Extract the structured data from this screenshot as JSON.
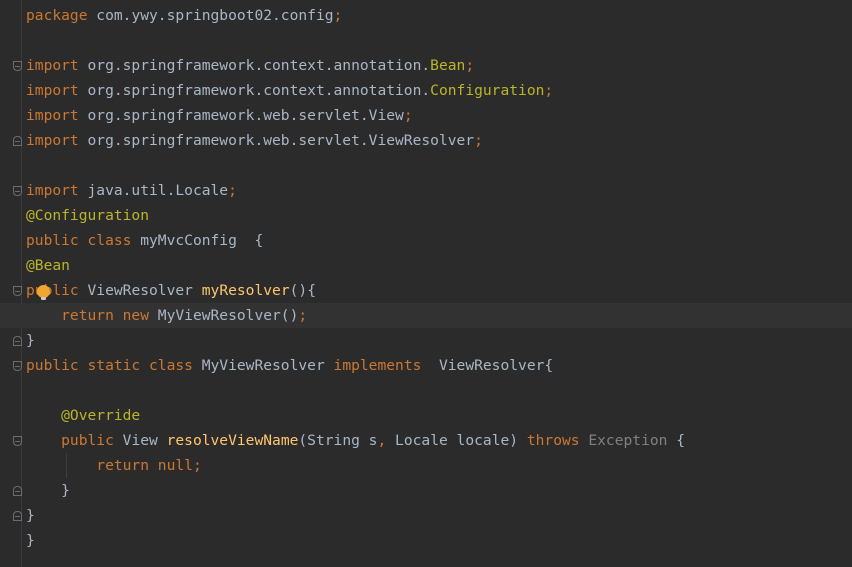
{
  "lines": [
    [
      {
        "t": "package",
        "c": "kw"
      },
      {
        "t": " com.ywy.springboot02.config",
        "c": "plain"
      },
      {
        "t": ";",
        "c": "kw"
      }
    ],
    [],
    [
      {
        "t": "import",
        "c": "kw"
      },
      {
        "t": " org.springframework.context.annotation.",
        "c": "plain"
      },
      {
        "t": "Bean",
        "c": "ann"
      },
      {
        "t": ";",
        "c": "kw"
      }
    ],
    [
      {
        "t": "import",
        "c": "kw"
      },
      {
        "t": " org.springframework.context.annotation.",
        "c": "plain"
      },
      {
        "t": "Configuration",
        "c": "ann"
      },
      {
        "t": ";",
        "c": "kw"
      }
    ],
    [
      {
        "t": "import",
        "c": "kw"
      },
      {
        "t": " org.springframework.web.servlet.View",
        "c": "plain"
      },
      {
        "t": ";",
        "c": "kw"
      }
    ],
    [
      {
        "t": "import",
        "c": "kw"
      },
      {
        "t": " org.springframework.web.servlet.ViewResolver",
        "c": "plain"
      },
      {
        "t": ";",
        "c": "kw"
      }
    ],
    [],
    [
      {
        "t": "import",
        "c": "kw"
      },
      {
        "t": " java.util.Locale",
        "c": "plain"
      },
      {
        "t": ";",
        "c": "kw"
      }
    ],
    [
      {
        "t": "@Configuration",
        "c": "ann"
      }
    ],
    [
      {
        "t": "public class ",
        "c": "kw"
      },
      {
        "t": "myMvcConfig  {",
        "c": "plain"
      }
    ],
    [
      {
        "t": "@Bean",
        "c": "ann"
      }
    ],
    [
      {
        "t": "public ",
        "c": "kw"
      },
      {
        "t": "ViewResolver ",
        "c": "plain"
      },
      {
        "t": "myResolver",
        "c": "fn"
      },
      {
        "t": "(){",
        "c": "plain"
      }
    ],
    [
      {
        "t": "    return new ",
        "c": "kw"
      },
      {
        "t": "MyViewResolver()",
        "c": "plain"
      },
      {
        "t": ";",
        "c": "kw"
      }
    ],
    [
      {
        "t": "}",
        "c": "plain"
      }
    ],
    [
      {
        "t": "public static class ",
        "c": "kw"
      },
      {
        "t": "MyViewResolver ",
        "c": "plain"
      },
      {
        "t": "implements  ",
        "c": "kw"
      },
      {
        "t": "ViewResolver{",
        "c": "plain"
      }
    ],
    [],
    [
      {
        "t": "    @Override",
        "c": "ann"
      }
    ],
    [
      {
        "t": "    public ",
        "c": "kw"
      },
      {
        "t": "View ",
        "c": "plain"
      },
      {
        "t": "resolveViewName",
        "c": "fn"
      },
      {
        "t": "(String s",
        "c": "plain"
      },
      {
        "t": ", ",
        "c": "kw"
      },
      {
        "t": "Locale locale) ",
        "c": "plain"
      },
      {
        "t": "throws ",
        "c": "kw"
      },
      {
        "t": "Exception",
        "c": "gray"
      },
      {
        "t": " {",
        "c": "plain"
      }
    ],
    [
      {
        "t": "        return null",
        "c": "kw"
      },
      {
        "t": ";",
        "c": "kw"
      }
    ],
    [
      {
        "t": "    }",
        "c": "plain"
      }
    ],
    [
      {
        "t": "}",
        "c": "plain"
      }
    ],
    [
      {
        "t": "}",
        "c": "plain"
      }
    ]
  ],
  "current_line_index": 12,
  "fold_markers": [
    {
      "line": 2,
      "dir": "down"
    },
    {
      "line": 5,
      "dir": "up"
    },
    {
      "line": 7,
      "dir": "down"
    },
    {
      "line": 11,
      "dir": "down"
    },
    {
      "line": 13,
      "dir": "up"
    },
    {
      "line": 14,
      "dir": "down"
    },
    {
      "line": 17,
      "dir": "down"
    },
    {
      "line": 19,
      "dir": "up"
    },
    {
      "line": 20,
      "dir": "up"
    }
  ],
  "colors": {
    "background": "#2b2b2b",
    "keyword": "#cc7832",
    "annotation": "#bbb529",
    "function": "#ffc66d",
    "text": "#a9b7c6"
  }
}
